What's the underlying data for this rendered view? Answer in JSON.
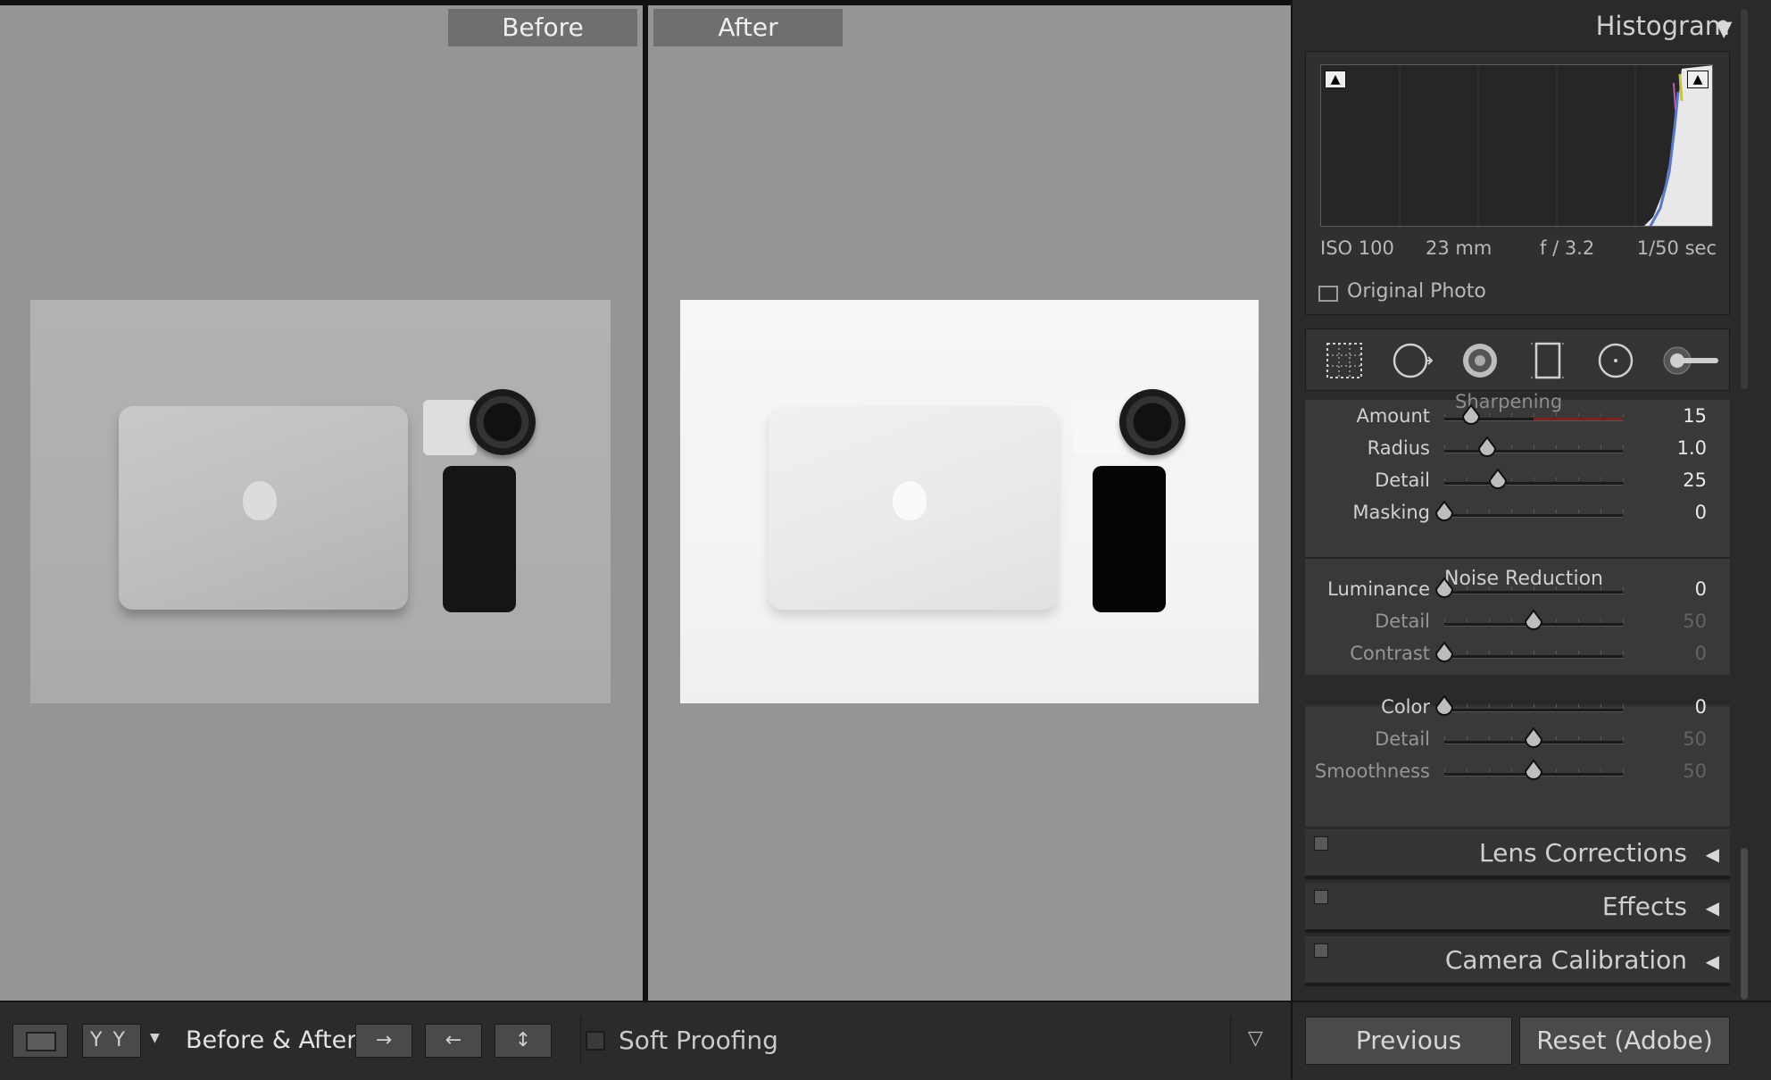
{
  "viewer": {
    "before_label": "Before",
    "after_label": "After"
  },
  "toolbar": {
    "loupe_icon": "loupe-view-icon",
    "yy_label": "YY",
    "mode_label": "Before & After :",
    "copy_right_icon": "→",
    "copy_left_icon": "←",
    "swap_icon": "↕",
    "soft_proofing_label": "Soft Proofing",
    "menu_icon": "▽"
  },
  "histogram": {
    "title": "Histogram",
    "toggle": "▼",
    "iso": "ISO 100",
    "focal": "23 mm",
    "aperture": "f / 3.2",
    "shutter": "1/50 sec",
    "original_photo_label": "Original Photo"
  },
  "tools": [
    "crop-overlay-icon",
    "spot-removal-icon",
    "red-eye-icon",
    "graduated-filter-icon",
    "radial-filter-icon",
    "adjustment-brush-icon"
  ],
  "detail": {
    "sharpening_title": "Sharpening",
    "noise_title": "Noise Reduction",
    "sharpening": [
      {
        "label": "Amount",
        "value": "15",
        "pos": 0.15
      },
      {
        "label": "Radius",
        "value": "1.0",
        "pos": 0.24
      },
      {
        "label": "Detail",
        "value": "25",
        "pos": 0.3
      },
      {
        "label": "Masking",
        "value": "0",
        "pos": 0.0
      }
    ],
    "noise_luma": [
      {
        "label": "Luminance",
        "value": "0",
        "pos": 0.0,
        "active": true
      },
      {
        "label": "Detail",
        "value": "50",
        "pos": 0.5,
        "active": false
      },
      {
        "label": "Contrast",
        "value": "0",
        "pos": 0.0,
        "active": false
      }
    ],
    "noise_color": [
      {
        "label": "Color",
        "value": "0",
        "pos": 0.0,
        "active": true
      },
      {
        "label": "Detail",
        "value": "50",
        "pos": 0.5,
        "active": false
      },
      {
        "label": "Smoothness",
        "value": "50",
        "pos": 0.5,
        "active": false
      }
    ]
  },
  "sections": {
    "lens": "Lens Corrections",
    "effects": "Effects",
    "calibration": "Camera Calibration",
    "collapsed_arrow": "◀"
  },
  "buttons": {
    "previous": "Previous",
    "reset": "Reset (Adobe)"
  },
  "colors": {
    "amount_track_accent": "#7c2020",
    "panel_bg": "#2a2a2a",
    "viewer_bg": "#959595"
  }
}
